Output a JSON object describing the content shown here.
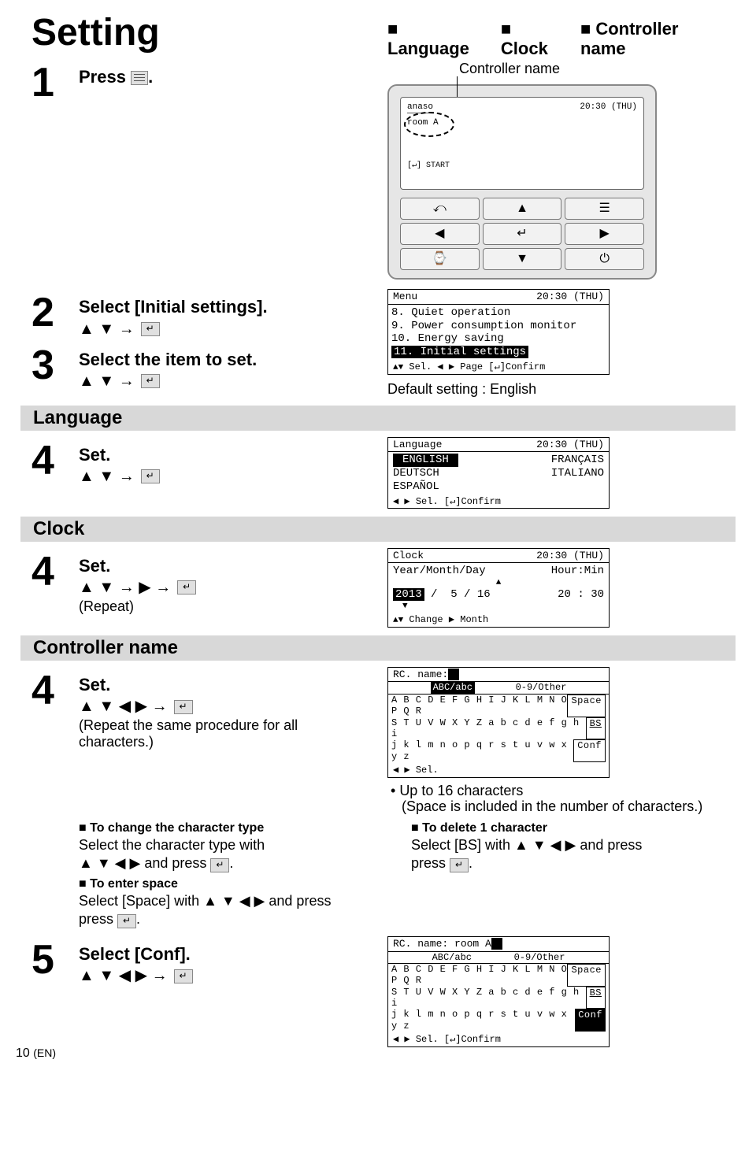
{
  "title": "Setting",
  "top_features": {
    "a": "Language",
    "b": "Clock",
    "c": "Controller name"
  },
  "controller_name_label": "Controller name",
  "step1": {
    "num": "1",
    "text": "Press",
    "end": "."
  },
  "device": {
    "brand": "anaso",
    "room": "room A",
    "time": "20:30 (THU)",
    "start": "[↵] START"
  },
  "step2": {
    "num": "2",
    "text": "Select [Initial settings].",
    "arrows": "▲ ▼ →"
  },
  "menu_screen": {
    "title": "Menu",
    "time": "20:30 (THU)",
    "i8": "8. Quiet operation",
    "i9": "9. Power consumption monitor",
    "i10": "10. Energy saving",
    "i11": "11. Initial settings",
    "footer": "Sel.  ◀ ▶ Page  [↵]Confirm"
  },
  "step3": {
    "num": "3",
    "text": "Select the item to set.",
    "arrows": "▲ ▼ →"
  },
  "default_note": "Default setting : English",
  "section_language": "Language",
  "step4a": {
    "num": "4",
    "text": "Set.",
    "arrows": "▲ ▼ →"
  },
  "lang_screen": {
    "title": "Language",
    "time": "20:30 (THU)",
    "opt": {
      "en": "ENGLISH",
      "fr": "FRANÇAIS",
      "de": "DEUTSCH",
      "it": "ITALIANO",
      "es": "ESPAÑOL"
    },
    "footer": "◀ ▶ Sel. [↵]Confirm"
  },
  "section_clock": "Clock",
  "step4b": {
    "num": "4",
    "text": "Set.",
    "arrows": "▲ ▼ → ▶ →",
    "repeat": "(Repeat)"
  },
  "clock_screen": {
    "title": "Clock",
    "time": "20:30 (THU)",
    "ymd_label": "Year/Month/Day",
    "hm_label": "Hour:Min",
    "year": "2013",
    "mon": "5",
    "day": "16",
    "hour": "20",
    "min": "30",
    "footer": "Change   ▶ Month"
  },
  "section_ctrl": "Controller name",
  "step4c": {
    "num": "4",
    "text": "Set.",
    "arrows": "▲ ▼ ◀ ▶ →",
    "repeat": "(Repeat the same procedure for all characters.)"
  },
  "name_screen1": {
    "title": "RC. name:",
    "tab1": "ABC/abc",
    "tab2": "0-9/Other",
    "r1": "A B C D E F G H I J K L M N O P Q R",
    "btn1": "Space",
    "r2": "S T U V W X Y Z   a b c d e f g h i",
    "btn2": "BS",
    "r3": "j k l m n o p q r s t u v w x y z",
    "btn3": "Conf",
    "footer": "◀ ▶ Sel."
  },
  "upto": "Up to 16 characters",
  "upto_sub": "(Space is included in the number of characters.)",
  "change_type_h": "To change the character type",
  "change_type_b": "Select the character type with",
  "change_type_b2": "▲ ▼ ◀ ▶ and press",
  "space_h": "To enter space",
  "space_b": "Select [Space] with ▲ ▼ ◀ ▶ and press",
  "delete_h": "To delete 1 character",
  "delete_b": "Select [BS] with ▲ ▼ ◀ ▶ and press",
  "step5": {
    "num": "5",
    "text": "Select [Conf].",
    "arrows": "▲ ▼ ◀ ▶ →"
  },
  "name_screen2": {
    "title": "RC. name: room A",
    "tab1": "ABC/abc",
    "tab2": "0-9/Other",
    "r1": "A B C D E F G H I J K L M N O P Q R",
    "btn1": "Space",
    "r2": "S T U V W X Y Z   a b c d e f g h i",
    "btn2": "BS",
    "r3": "j k l m n o p q r s t u v w x y z",
    "btn3": "Conf",
    "footer": "◀ ▶ Sel. [↵]Confirm"
  },
  "page_num": "10",
  "page_en": "(EN)"
}
